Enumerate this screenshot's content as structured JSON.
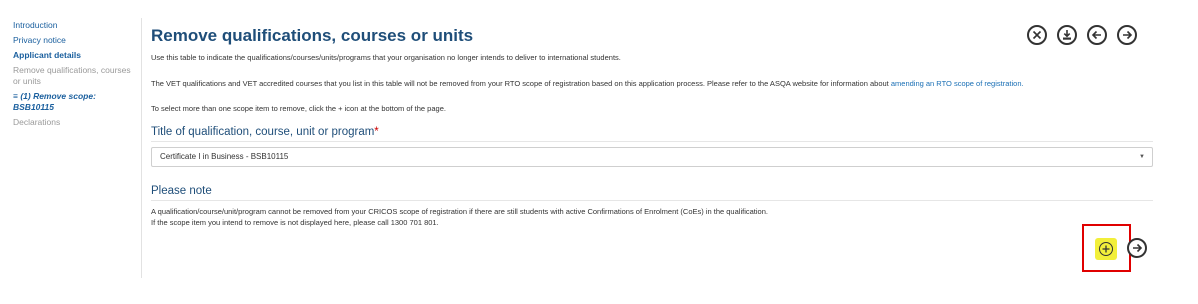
{
  "sidebar": {
    "items": [
      {
        "label": "Introduction"
      },
      {
        "label": "Privacy notice"
      },
      {
        "label": "Applicant details"
      },
      {
        "label": "Remove qualifications, courses or units"
      },
      {
        "label": "≡ (1) Remove scope: BSB10115"
      },
      {
        "label": "Declarations"
      }
    ]
  },
  "main": {
    "title": "Remove qualifications, courses or units",
    "intro": "Use this table to indicate the qualifications/courses/units/programs that your organisation no longer intends to deliver to international students.",
    "vet_text": "The VET qualifications and VET accredited courses that you list in this table will not be removed from your RTO scope of registration based on this application process. Please refer to the ASQA website for information about",
    "vet_link": "amending an RTO scope of registration.",
    "select_text": "To select more than one scope item to remove, click the + icon at the bottom of the page.",
    "field_label": "Title of qualification, course, unit or program",
    "required_mark": "*",
    "field_value": "Certificate I in Business - BSB10115",
    "note_heading": "Please note",
    "note_line1": "A qualification/course/unit/program cannot be removed from your CRICOS scope of registration if there are still students with active Confirmations of Enrolment (CoEs) in the qualification.",
    "note_line2": "If the scope item you intend to remove is not displayed here, please call 1300 701 801."
  },
  "icons": {
    "top": [
      "close-icon",
      "save-icon",
      "back-icon",
      "forward-icon"
    ],
    "bottom": [
      "add-icon",
      "forward-icon"
    ]
  },
  "colors": {
    "title": "#1f4e79",
    "link": "#1a5f9e",
    "required": "#cc0000",
    "highlight": "#f2ef3a",
    "annotation_box": "#e00000"
  }
}
